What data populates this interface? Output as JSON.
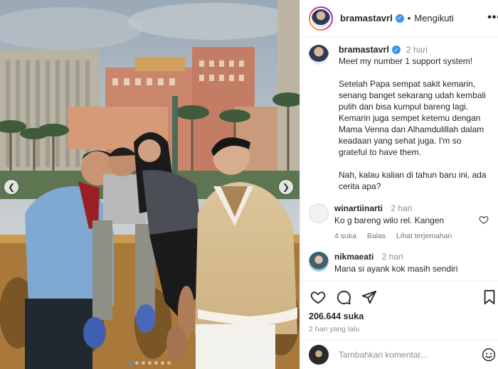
{
  "post": {
    "username": "bramastavrl",
    "follow_status": "Mengikuti",
    "more_label": "•••",
    "caption_time": "2 hari",
    "caption": "Meet my number 1 support system!\n\nSetelah Papa sempat sakit kemarin, senang banget sekarang udah kembali pulih dan bisa kumpul bareng lagi. Kemarin juga sempet ketemu dengan Mama Venna dan Alhamdulillah dalam keadaan yang sehat juga. I'm so grateful to have them.\n\nNah, kalau kalian di tahun baru ini, ada cerita apa?",
    "likes": "206.644 suka",
    "posted": "2 hari yang lalu",
    "carousel": {
      "prev_icon": "chevron-left-icon",
      "next_icon": "chevron-right-icon",
      "slide_count": 7,
      "current_slide": 1
    }
  },
  "comments": [
    {
      "username": "winartiinarti",
      "time": "2 hari",
      "text": "Ko g bareng wilo rel. Kangen",
      "likes": "4 suka",
      "reply": "Balas",
      "translate": "Lihat terjemahan"
    },
    {
      "username": "nikmaeati",
      "time": "2 hari",
      "text": "Mana si ayank kok masih sendiri"
    }
  ],
  "composer": {
    "placeholder": "Tambahkan komentar..."
  },
  "colors": {
    "accent": "#3797f0",
    "text": "#262626",
    "muted": "#8e8e8e"
  }
}
